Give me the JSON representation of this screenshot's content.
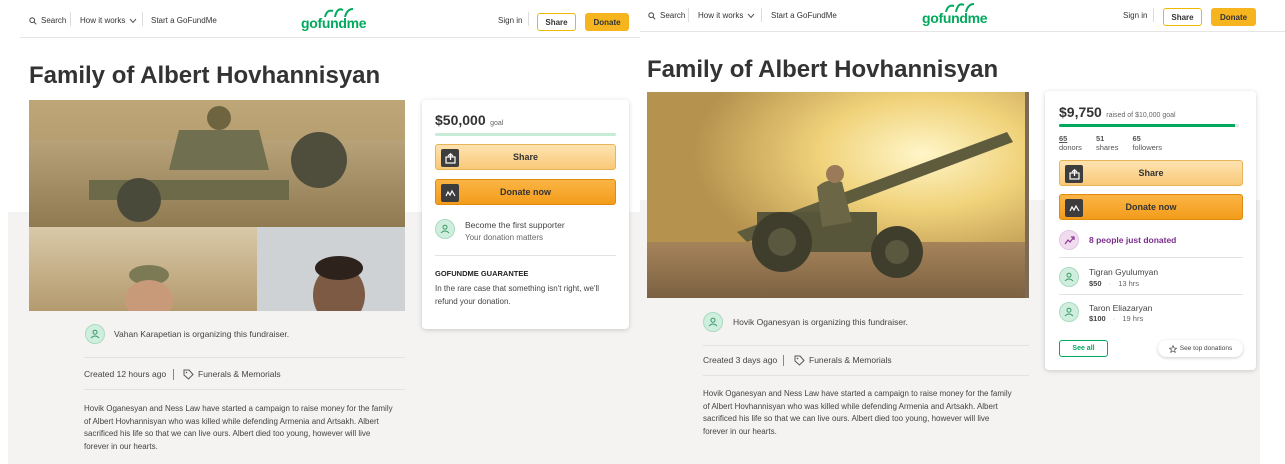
{
  "left": {
    "header": {
      "search": "Search",
      "how_it_works": "How it works",
      "start": "Start a GoFundMe",
      "logo": "gofundme",
      "sign_in": "Sign in",
      "share": "Share",
      "donate": "Donate"
    },
    "title": "Family of Albert Hovhannisyan",
    "card": {
      "amount": "$50,000",
      "goal_label": "goal",
      "progress": 0,
      "share": "Share",
      "donate_now": "Donate now",
      "first_supporter": "Become the first supporter",
      "donation_matters": "Your donation matters",
      "guarantee_title": "GOFUNDME GUARANTEE",
      "guarantee_text_1": "In the rare case that something isn't right, we'll",
      "guarantee_text_2": "refund your donation."
    },
    "organizer": "Vahan Karapetian is organizing this fundraiser.",
    "created": "Created 12 hours ago",
    "category": "Funerals & Memorials",
    "story": [
      "Hovik Oganesyan and Ness Law have started a campaign to raise money for the family",
      "of Albert Hovhannisyan who was killed while defending Armenia and Artsakh.  Albert",
      "sacrificed his life so that we can live ours.  Albert died too young, however will live",
      "forever in our hearts."
    ]
  },
  "right": {
    "header": {
      "search": "Search",
      "how_it_works": "How it works",
      "start": "Start a GoFundMe",
      "logo": "gofundme",
      "sign_in": "Sign in",
      "share": "Share",
      "donate": "Donate"
    },
    "title": "Family of Albert Hovhannisyan",
    "card": {
      "amount": "$9,750",
      "raised_text": "raised of $10,000 goal",
      "progress": 0.975,
      "stats": [
        {
          "value": "65",
          "label": "donors"
        },
        {
          "value": "51",
          "label": "shares"
        },
        {
          "value": "65",
          "label": "followers"
        }
      ],
      "share": "Share",
      "donate_now": "Donate now",
      "just_donated": "8 people just donated",
      "donations": [
        {
          "name": "Tigran Gyulumyan",
          "amount": "$50",
          "time": "13 hrs"
        },
        {
          "name": "Taron Eliazaryan",
          "amount": "$100",
          "time": "19 hrs"
        }
      ],
      "see_all": "See all",
      "see_top": "See top donations"
    },
    "organizer": "Hovik Oganesyan is organizing this fundraiser.",
    "created": "Created 3 days ago",
    "category": "Funerals & Memorials",
    "story": [
      "Hovik Oganesyan and Ness Law have started a campaign to raise money for the family",
      "of Albert Hovhannisyan who was killed while defending Armenia and Artsakh.  Albert",
      "sacrificed his life so that we can live ours.  Albert died too young, however will live",
      "forever in our hearts."
    ]
  },
  "colors": {
    "brand": "#02a95c",
    "donate": "#f6b51e",
    "purple": "#7a2d8c"
  }
}
